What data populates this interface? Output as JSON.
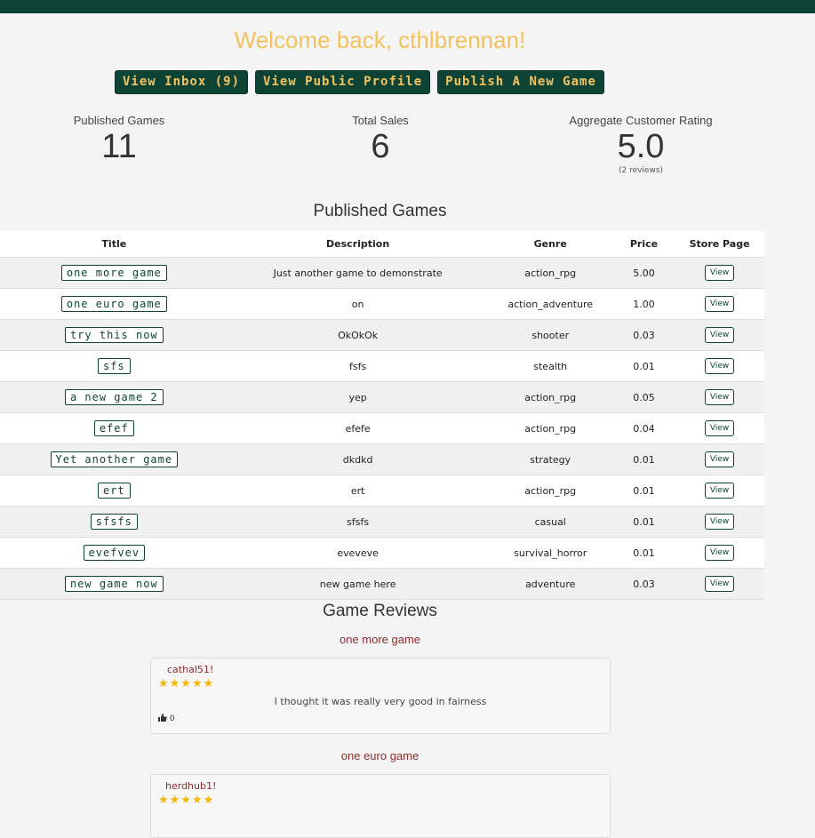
{
  "header": {
    "welcome": "Welcome back, cthlbrennan!",
    "buttons": [
      "View Inbox (9)",
      "View Public Profile",
      "Publish A New Game"
    ]
  },
  "stats": {
    "published_label": "Published Games",
    "published_value": "11",
    "sales_label": "Total Sales",
    "sales_value": "6",
    "rating_label": "Aggregate Customer Rating",
    "rating_value": "5.0",
    "rating_reviews": "(2 reviews)"
  },
  "games_section": {
    "title": "Published Games",
    "columns": [
      "Title",
      "Description",
      "Genre",
      "Price",
      "Store Page"
    ],
    "rows": [
      {
        "title": "one more game",
        "description": "Just another game to demonstrate",
        "genre": "action_rpg",
        "price": "5.00",
        "action": "View"
      },
      {
        "title": "one euro game",
        "description": "on",
        "genre": "action_adventure",
        "price": "1.00",
        "action": "View"
      },
      {
        "title": "try this now",
        "description": "OkOkOk",
        "genre": "shooter",
        "price": "0.03",
        "action": "View"
      },
      {
        "title": "sfs",
        "description": "fsfs",
        "genre": "stealth",
        "price": "0.01",
        "action": "View"
      },
      {
        "title": "a new game 2",
        "description": "yep",
        "genre": "action_rpg",
        "price": "0.05",
        "action": "View"
      },
      {
        "title": "efef",
        "description": "efefe",
        "genre": "action_rpg",
        "price": "0.04",
        "action": "View"
      },
      {
        "title": "Yet another game",
        "description": "dkdkd",
        "genre": "strategy",
        "price": "0.01",
        "action": "View"
      },
      {
        "title": "ert",
        "description": "ert",
        "genre": "action_rpg",
        "price": "0.01",
        "action": "View"
      },
      {
        "title": "sfsfs",
        "description": "sfsfs",
        "genre": "casual",
        "price": "0.01",
        "action": "View"
      },
      {
        "title": "evefvev",
        "description": "eveveve",
        "genre": "survival_horror",
        "price": "0.01",
        "action": "View"
      },
      {
        "title": "new game now",
        "description": "new game here",
        "genre": "adventure",
        "price": "0.03",
        "action": "View"
      }
    ]
  },
  "reviews_section": {
    "title": "Game Reviews",
    "reviews": [
      {
        "game": "one more game",
        "user": "cathal51!",
        "stars": "★★★★★",
        "rating": 5,
        "text": "I thought it was really very good in fairness",
        "likes": "0"
      },
      {
        "game": "one euro game",
        "user": "herdhub1!",
        "stars": "★★★★★",
        "rating": 5,
        "text": "",
        "likes": ""
      }
    ]
  },
  "colors": {
    "brand": "#0e4436",
    "accent": "#f3c25e",
    "review_name": "#8b2c2c",
    "star": "#f2b705"
  },
  "icons": {
    "thumbs_up": "thumbs-up-icon",
    "star": "star-icon"
  }
}
